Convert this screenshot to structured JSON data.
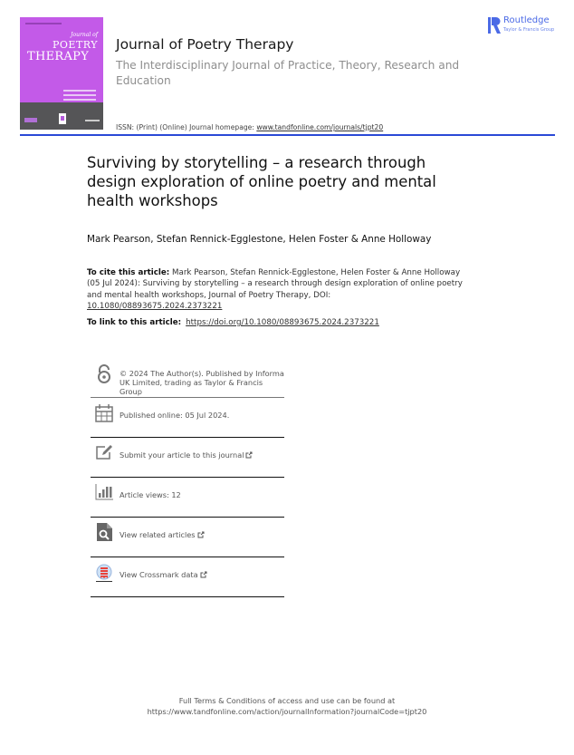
{
  "cover": {
    "journal_of": "Journal of",
    "poetry": "POETRY",
    "therapy": "THERAPY",
    "colors": {
      "background": "#c35ae8",
      "band": "#555557"
    }
  },
  "header": {
    "journal_title": "Journal of Poetry Therapy",
    "journal_subtitle": "The Interdisciplinary Journal of Practice, Theory, Research and Education",
    "issn_label": "ISSN: (Print) (Online) Journal homepage: ",
    "homepage_link": "www.tandfonline.com/journals/tjpt20",
    "rule_color": "#2a49d6"
  },
  "publisher": {
    "name": "Routledge",
    "tagline": "Taylor & Francis Group",
    "color": "#4b6ae6"
  },
  "article": {
    "title": "Surviving by storytelling – a research through design exploration of online poetry and mental health workshops",
    "authors": "Mark Pearson, Stefan Rennick-Egglestone, Helen Foster & Anne Holloway",
    "cite_label": "To cite this article:",
    "cite_text": " Mark Pearson, Stefan Rennick-Egglestone, Helen Foster & Anne Holloway (05 Jul 2024): Surviving by storytelling – a research through design exploration of online poetry and mental health workshops, Journal of Poetry Therapy, DOI: ",
    "cite_doi": "10.1080/08893675.2024.2373221",
    "link_label": "To link to this article:",
    "link_url": "https://doi.org/10.1080/08893675.2024.2373221"
  },
  "info_items": [
    {
      "icon": "open-access-icon",
      "text": "© 2024 The Author(s). Published by Informa UK Limited, trading as Taylor & Francis Group"
    },
    {
      "icon": "calendar-icon",
      "text": "Published online: 05 Jul 2024."
    },
    {
      "icon": "edit-icon",
      "text": "Submit your article to this journal"
    },
    {
      "icon": "bar-chart-icon",
      "text": "Article views: 12"
    },
    {
      "icon": "search-document-icon",
      "text": "View related articles"
    },
    {
      "icon": "crossmark-icon",
      "text": "View Crossmark data"
    }
  ],
  "footer": {
    "line1": "Full Terms & Conditions of access and use can be found at",
    "line2": "https://www.tandfonline.com/action/journalInformation?journalCode=tjpt20"
  }
}
